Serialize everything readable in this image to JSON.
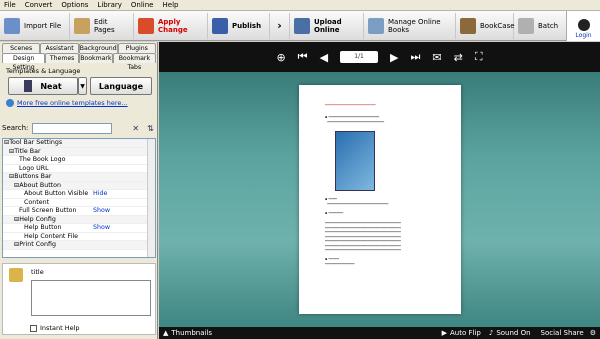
{
  "menu": [
    "File",
    "Convert",
    "Options",
    "Library",
    "Online",
    "Help"
  ],
  "toolbar": {
    "import": "Import File",
    "edit": "Edit Pages",
    "apply": "Apply Change",
    "publish": "Publish",
    "upload": "Upload Online",
    "manage": "Manage Online Books",
    "bookcase": "BookCase",
    "batch": "Batch",
    "login": "Login"
  },
  "tabs_row1": [
    "Scenes",
    "Assistant",
    "Background",
    "Plugins"
  ],
  "tabs_row2": [
    "Design Setting",
    "Themes",
    "Bookmark",
    "Bookmark Tabs"
  ],
  "templates_label": "Templates & Language",
  "theme_button": "Neat",
  "language_button": "Language",
  "more_templates": "More free online templates here...",
  "search_label": "Search:",
  "tree": [
    {
      "k": "⊟Tool Bar Settings",
      "v": "",
      "ind": 0,
      "grp": true
    },
    {
      "k": "⊟Title Bar",
      "v": "",
      "ind": 1,
      "grp": true
    },
    {
      "k": "The Book Logo",
      "v": "",
      "ind": 3
    },
    {
      "k": "Logo URL",
      "v": "",
      "ind": 3
    },
    {
      "k": "⊟Buttons Bar",
      "v": "",
      "ind": 1,
      "grp": true
    },
    {
      "k": "⊟About Button",
      "v": "",
      "ind": 2,
      "grp": true
    },
    {
      "k": "About Button Visible",
      "v": "Hide",
      "ind": 4
    },
    {
      "k": "Content",
      "v": "",
      "ind": 4
    },
    {
      "k": "Full Screen Button",
      "v": "Show",
      "ind": 3
    },
    {
      "k": "⊟Help Config",
      "v": "",
      "ind": 2,
      "grp": true
    },
    {
      "k": "Help Button",
      "v": "Show",
      "ind": 4
    },
    {
      "k": "Help Content File",
      "v": "",
      "ind": 4
    },
    {
      "k": "⊟Print Config",
      "v": "",
      "ind": 2,
      "grp": true
    }
  ],
  "prop_title": "title",
  "instant_help": "Instant Help",
  "viewer": {
    "page_indicator": "1/1",
    "thumbnails": "Thumbnails",
    "auto_flip": "Auto Flip",
    "sound_on": "Sound On",
    "social_share": "Social Share"
  }
}
